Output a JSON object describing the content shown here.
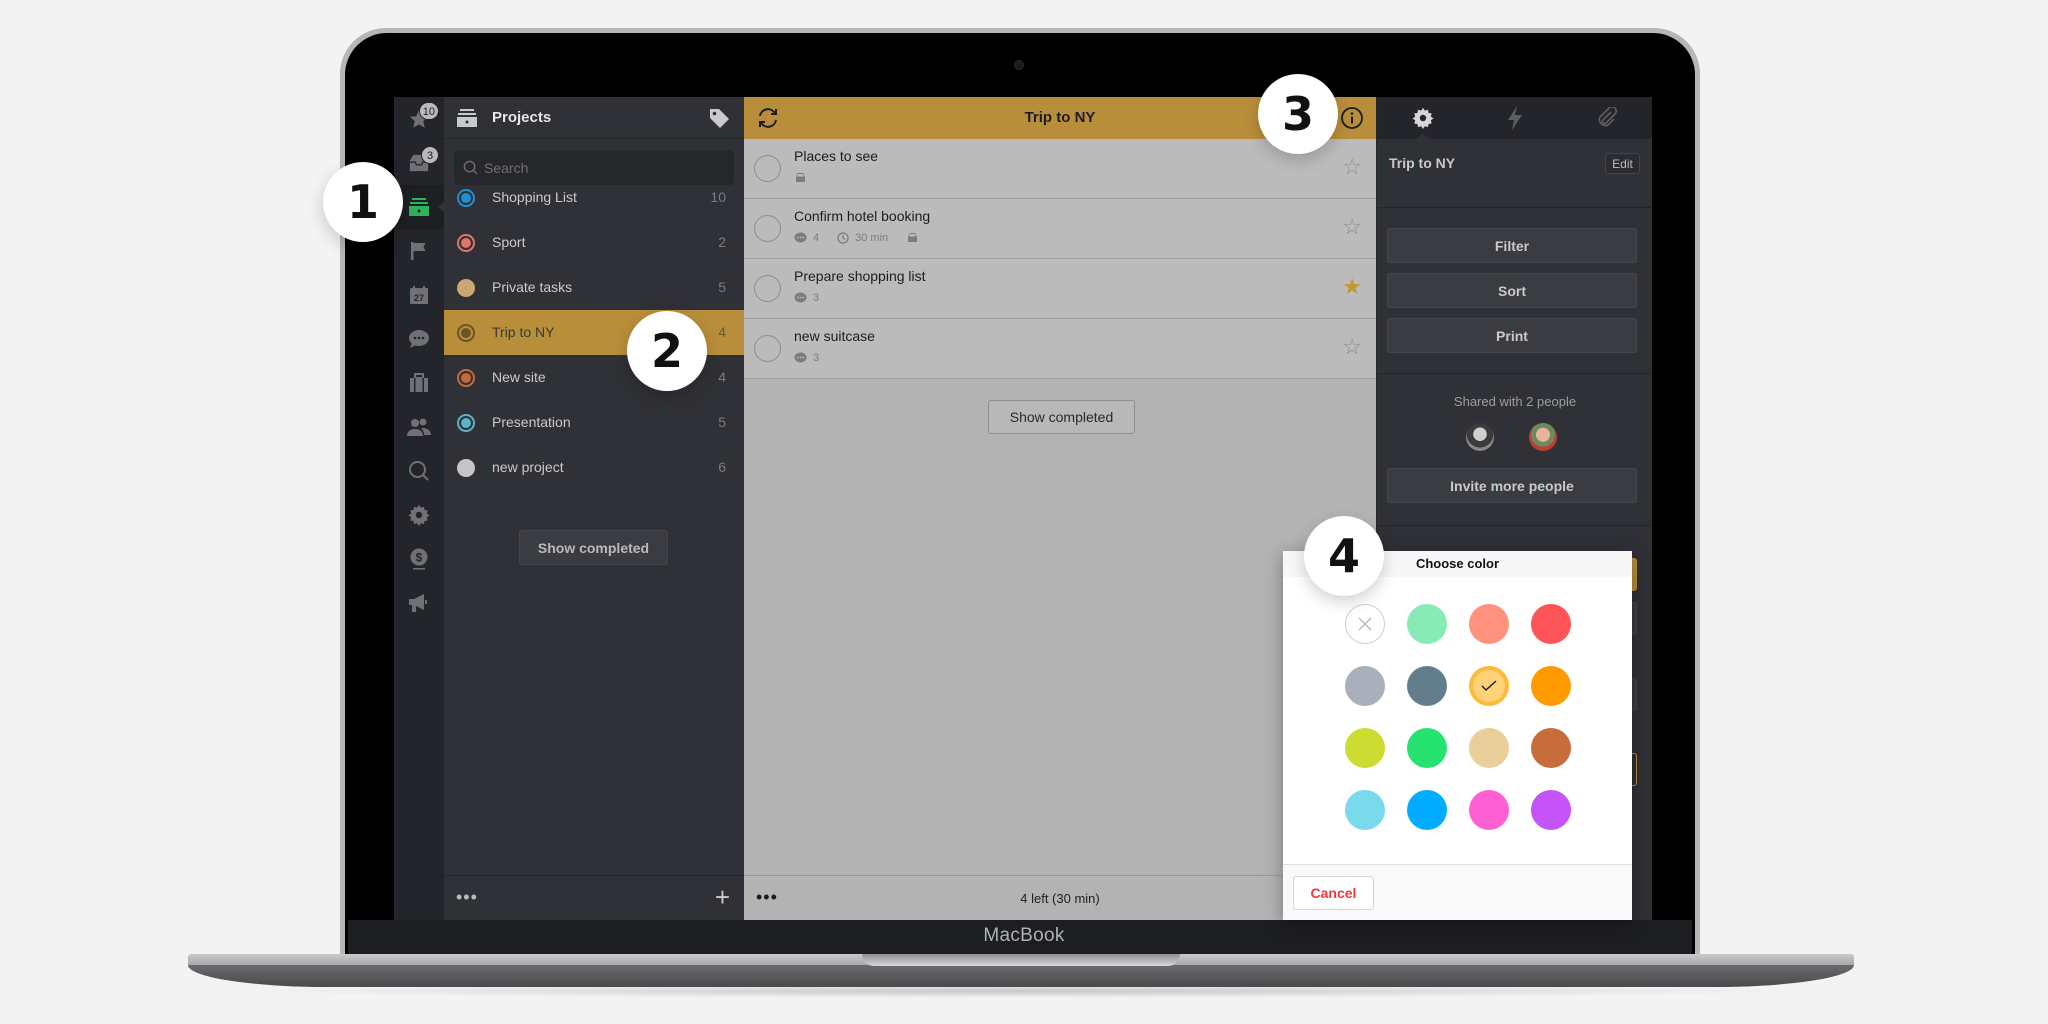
{
  "device": {
    "label": "MacBook"
  },
  "callouts": [
    "1",
    "2",
    "3",
    "4"
  ],
  "rail": {
    "items": [
      {
        "icon": "starred-icon",
        "badge": "10"
      },
      {
        "icon": "inbox-icon",
        "badge": "3"
      },
      {
        "icon": "projects-icon",
        "active": true
      },
      {
        "icon": "flag-icon"
      },
      {
        "icon": "calendar-icon",
        "text": "27"
      },
      {
        "icon": "chat-icon"
      },
      {
        "icon": "briefcase-icon"
      },
      {
        "icon": "people-icon"
      },
      {
        "icon": "search-icon"
      },
      {
        "icon": "gear-icon"
      },
      {
        "icon": "dollar-icon"
      },
      {
        "icon": "megaphone-icon"
      }
    ]
  },
  "projects": {
    "title": "Projects",
    "search_placeholder": "Search",
    "items": [
      {
        "name": "Shopping List",
        "count": "10",
        "color": "#1f8fd6",
        "style": "ring"
      },
      {
        "name": "Sport",
        "count": "2",
        "color": "#e0766a",
        "style": "ring"
      },
      {
        "name": "Private tasks",
        "count": "5",
        "color": "#c9a874",
        "style": "solid"
      },
      {
        "name": "Trip to NY",
        "count": "4",
        "color": "#6b5425",
        "style": "ring",
        "selected": true
      },
      {
        "name": "New site",
        "count": "4",
        "color": "#c56a3a",
        "style": "ring"
      },
      {
        "name": "Presentation",
        "count": "5",
        "color": "#5ab4c3",
        "style": "ring"
      },
      {
        "name": "new project",
        "count": "6",
        "color": "#c5c5c5",
        "style": "solid"
      }
    ],
    "show_completed": "Show completed"
  },
  "tasks": {
    "title": "Trip to NY",
    "items": [
      {
        "name": "Places to see",
        "comments": "",
        "duration": "",
        "car": true,
        "starred": false
      },
      {
        "name": "Confirm hotel booking",
        "comments": "4",
        "duration": "30 min",
        "car": true,
        "starred": false
      },
      {
        "name": "Prepare shopping list",
        "comments": "3",
        "duration": "",
        "car": false,
        "starred": true
      },
      {
        "name": "new suitcase",
        "comments": "3",
        "duration": "",
        "car": false,
        "starred": false
      }
    ],
    "show_completed": "Show completed",
    "status": "4 left (30 min)"
  },
  "info_panel": {
    "tabs": [
      "settings",
      "actions",
      "attachments"
    ],
    "project_name": "Trip to NY",
    "edit_label": "Edit",
    "buttons": {
      "filter": "Filter",
      "sort": "Sort",
      "print": "Print"
    },
    "shared_text": "Shared with 2 people",
    "invite_label": "Invite more people"
  },
  "color_picker": {
    "title": "Choose color",
    "cancel_label": "Cancel",
    "selected": "#ffd479",
    "swatches": [
      [
        "none",
        "#88eab4",
        "#ff917d",
        "#ff5457"
      ],
      [
        "#a9b0bb",
        "#627e8c",
        "#ffd479",
        "#ff9b00"
      ],
      [
        "#cddc33",
        "#26e271",
        "#ebcf9a",
        "#c76c3b"
      ],
      [
        "#79d9ed",
        "#00acff",
        "#ff60d4",
        "#c454f8"
      ]
    ]
  },
  "accent": "#b98e3a"
}
